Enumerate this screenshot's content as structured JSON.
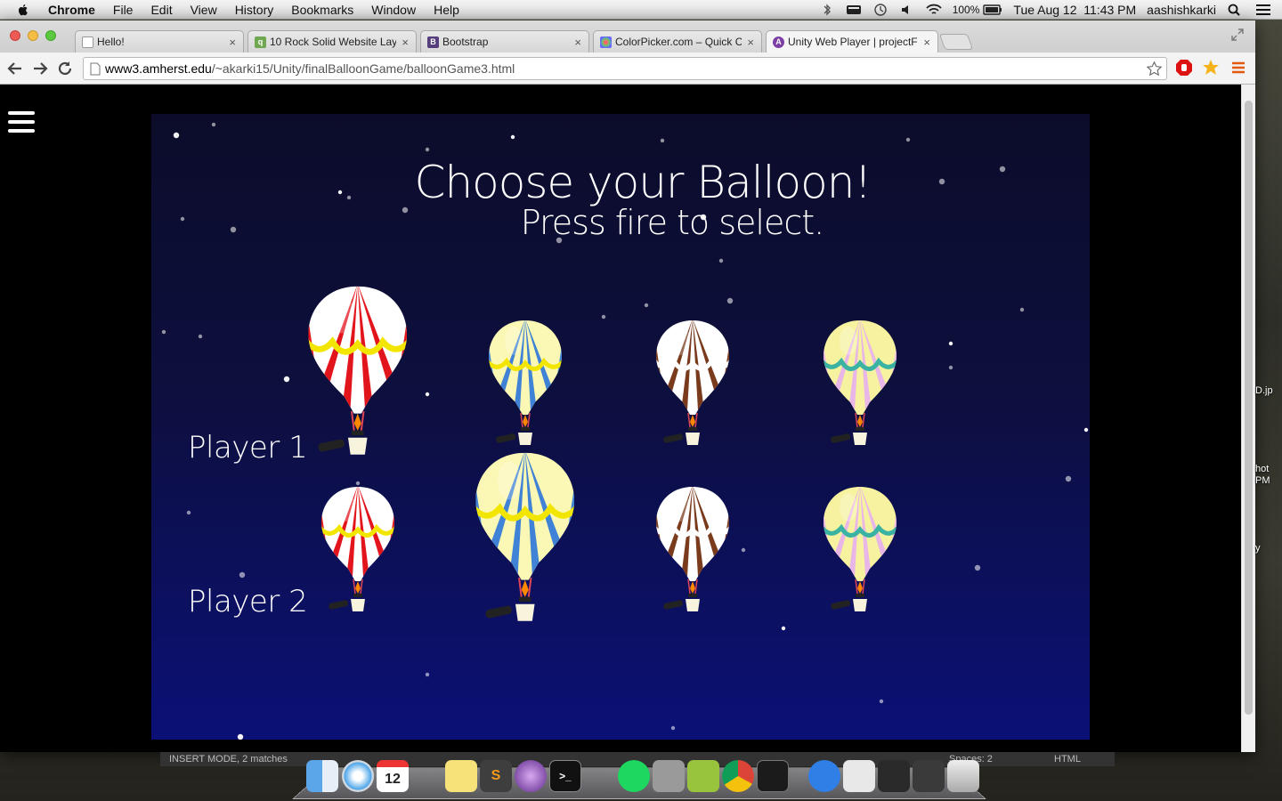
{
  "menubar": {
    "app_name": "Chrome",
    "menus": [
      "File",
      "Edit",
      "View",
      "History",
      "Bookmarks",
      "Window",
      "Help"
    ],
    "battery": "100%",
    "datetime": "Tue Aug 12  11:43 PM",
    "user": "aashishkarki"
  },
  "tabs": [
    {
      "title": "Hello!",
      "favicon": "page-icon"
    },
    {
      "title": "10 Rock Solid Website Layo",
      "favicon": "q-icon"
    },
    {
      "title": "Bootstrap",
      "favicon": "bootstrap-icon"
    },
    {
      "title": "ColorPicker.com – Quick C",
      "favicon": "palette-icon"
    },
    {
      "title": "Unity Web Player | projectF",
      "favicon": "unity-icon"
    }
  ],
  "url": {
    "host": "www3.amherst.edu",
    "path": "/~akarki15/Unity/finalBalloonGame/balloonGame3.html"
  },
  "game": {
    "title": "Choose your Balloon!",
    "subtitle": "Press fire to select.",
    "players": [
      {
        "label": "Player 1",
        "selected_balloon": "red-white"
      },
      {
        "label": "Player 2",
        "selected_balloon": "blue-yellow"
      }
    ],
    "balloons": [
      {
        "name": "red-white",
        "stripe_a": "#e3151c",
        "stripe_b": "#ffffff",
        "garland": "#f2e600"
      },
      {
        "name": "blue-yellow",
        "stripe_a": "#3f82d6",
        "stripe_b": "#fbf7b4",
        "garland": "#f2e600"
      },
      {
        "name": "brown-white",
        "stripe_a": "#7a3b1d",
        "stripe_b": "#ffffff",
        "garland": "#ffffff"
      },
      {
        "name": "pink-yellow",
        "stripe_a": "#e9b6e8",
        "stripe_b": "#f6f2a0",
        "garland": "#3bb3a2"
      }
    ]
  },
  "editor_status": {
    "mode": "INSERT MODE, 2 matches",
    "spaces": "Spaces: 2",
    "language": "HTML"
  },
  "dock": {
    "calendar_day": "12"
  },
  "desktop_labels": [
    "D.jp",
    "hot",
    "PM",
    "y"
  ]
}
